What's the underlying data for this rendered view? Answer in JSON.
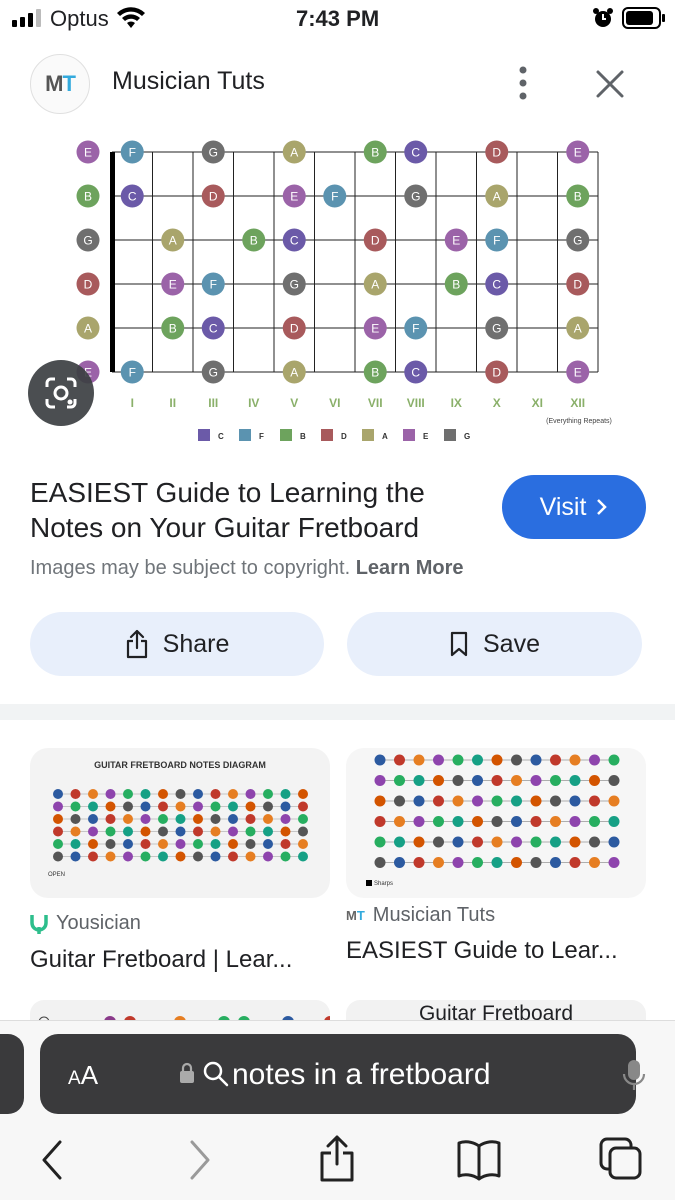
{
  "status_bar": {
    "carrier": "Optus",
    "time": "7:43 PM"
  },
  "header": {
    "logo_text_m": "M",
    "logo_text_t": "T",
    "site_name": "Musician Tuts",
    "more_icon": "more-vert-icon",
    "close_icon": "close-icon"
  },
  "fretboard": {
    "strings": [
      "E",
      "B",
      "G",
      "D",
      "A",
      "E"
    ],
    "fret_numerals": [
      "I",
      "II",
      "III",
      "IV",
      "V",
      "VI",
      "VII",
      "VIII",
      "IX",
      "X",
      "XI",
      "XII"
    ],
    "repeat_note": "(Everything Repeats)",
    "legend": [
      {
        "label": "C",
        "color": "#6b5aa8"
      },
      {
        "label": "F",
        "color": "#5b93b0"
      },
      {
        "label": "B",
        "color": "#6da35d"
      },
      {
        "label": "D",
        "color": "#a85a5c"
      },
      {
        "label": "A",
        "color": "#a9a56c"
      },
      {
        "label": "E",
        "color": "#9b63a8"
      },
      {
        "label": "G",
        "color": "#6f6f6f"
      }
    ]
  },
  "result": {
    "title": "EASIEST Guide to Learning the Notes on Your Guitar Fretboard",
    "visit_label": "Visit",
    "copyright_text": "Images may be subject to copyright.",
    "learn_more": "Learn More",
    "share_label": "Share",
    "save_label": "Save"
  },
  "related": [
    {
      "image_heading": "GUITAR FRETBOARD NOTES DIAGRAM",
      "open_label": "OPEN",
      "source": "Yousician",
      "title": "Guitar Fretboard | Lear..."
    },
    {
      "sharps_label": "Sharps",
      "source": "Musician Tuts",
      "title": "EASIEST Guide to Lear..."
    }
  ],
  "peek_card_title": "Guitar Fretboard",
  "browser": {
    "aa_small": "A",
    "aa_big": "A",
    "url": "notes in a fretboard"
  }
}
